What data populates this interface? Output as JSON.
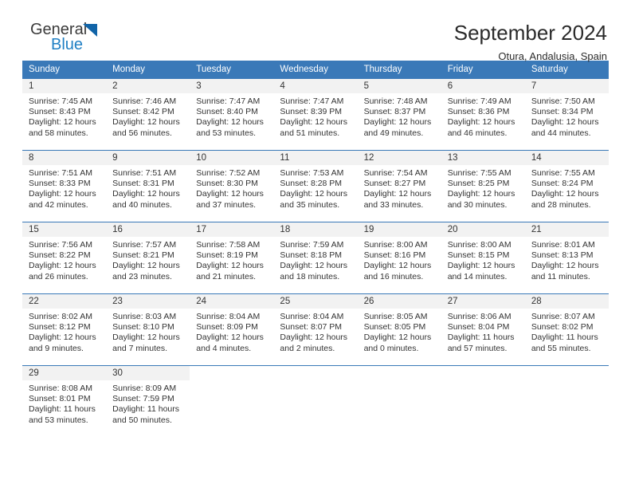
{
  "brand": {
    "line1": "General",
    "line2": "Blue",
    "triangle_icon": "triangle-icon"
  },
  "header": {
    "title": "September 2024",
    "subtitle": "Otura, Andalusia, Spain"
  },
  "colors": {
    "header_blue": "#3a79b8",
    "brand_blue": "#1f7fc4",
    "daynum_bg": "#f2f2f2"
  },
  "weekdays": [
    "Sunday",
    "Monday",
    "Tuesday",
    "Wednesday",
    "Thursday",
    "Friday",
    "Saturday"
  ],
  "weeks": [
    [
      {
        "day": "1",
        "sunrise": "Sunrise: 7:45 AM",
        "sunset": "Sunset: 8:43 PM",
        "daylight1": "Daylight: 12 hours",
        "daylight2": "and 58 minutes."
      },
      {
        "day": "2",
        "sunrise": "Sunrise: 7:46 AM",
        "sunset": "Sunset: 8:42 PM",
        "daylight1": "Daylight: 12 hours",
        "daylight2": "and 56 minutes."
      },
      {
        "day": "3",
        "sunrise": "Sunrise: 7:47 AM",
        "sunset": "Sunset: 8:40 PM",
        "daylight1": "Daylight: 12 hours",
        "daylight2": "and 53 minutes."
      },
      {
        "day": "4",
        "sunrise": "Sunrise: 7:47 AM",
        "sunset": "Sunset: 8:39 PM",
        "daylight1": "Daylight: 12 hours",
        "daylight2": "and 51 minutes."
      },
      {
        "day": "5",
        "sunrise": "Sunrise: 7:48 AM",
        "sunset": "Sunset: 8:37 PM",
        "daylight1": "Daylight: 12 hours",
        "daylight2": "and 49 minutes."
      },
      {
        "day": "6",
        "sunrise": "Sunrise: 7:49 AM",
        "sunset": "Sunset: 8:36 PM",
        "daylight1": "Daylight: 12 hours",
        "daylight2": "and 46 minutes."
      },
      {
        "day": "7",
        "sunrise": "Sunrise: 7:50 AM",
        "sunset": "Sunset: 8:34 PM",
        "daylight1": "Daylight: 12 hours",
        "daylight2": "and 44 minutes."
      }
    ],
    [
      {
        "day": "8",
        "sunrise": "Sunrise: 7:51 AM",
        "sunset": "Sunset: 8:33 PM",
        "daylight1": "Daylight: 12 hours",
        "daylight2": "and 42 minutes."
      },
      {
        "day": "9",
        "sunrise": "Sunrise: 7:51 AM",
        "sunset": "Sunset: 8:31 PM",
        "daylight1": "Daylight: 12 hours",
        "daylight2": "and 40 minutes."
      },
      {
        "day": "10",
        "sunrise": "Sunrise: 7:52 AM",
        "sunset": "Sunset: 8:30 PM",
        "daylight1": "Daylight: 12 hours",
        "daylight2": "and 37 minutes."
      },
      {
        "day": "11",
        "sunrise": "Sunrise: 7:53 AM",
        "sunset": "Sunset: 8:28 PM",
        "daylight1": "Daylight: 12 hours",
        "daylight2": "and 35 minutes."
      },
      {
        "day": "12",
        "sunrise": "Sunrise: 7:54 AM",
        "sunset": "Sunset: 8:27 PM",
        "daylight1": "Daylight: 12 hours",
        "daylight2": "and 33 minutes."
      },
      {
        "day": "13",
        "sunrise": "Sunrise: 7:55 AM",
        "sunset": "Sunset: 8:25 PM",
        "daylight1": "Daylight: 12 hours",
        "daylight2": "and 30 minutes."
      },
      {
        "day": "14",
        "sunrise": "Sunrise: 7:55 AM",
        "sunset": "Sunset: 8:24 PM",
        "daylight1": "Daylight: 12 hours",
        "daylight2": "and 28 minutes."
      }
    ],
    [
      {
        "day": "15",
        "sunrise": "Sunrise: 7:56 AM",
        "sunset": "Sunset: 8:22 PM",
        "daylight1": "Daylight: 12 hours",
        "daylight2": "and 26 minutes."
      },
      {
        "day": "16",
        "sunrise": "Sunrise: 7:57 AM",
        "sunset": "Sunset: 8:21 PM",
        "daylight1": "Daylight: 12 hours",
        "daylight2": "and 23 minutes."
      },
      {
        "day": "17",
        "sunrise": "Sunrise: 7:58 AM",
        "sunset": "Sunset: 8:19 PM",
        "daylight1": "Daylight: 12 hours",
        "daylight2": "and 21 minutes."
      },
      {
        "day": "18",
        "sunrise": "Sunrise: 7:59 AM",
        "sunset": "Sunset: 8:18 PM",
        "daylight1": "Daylight: 12 hours",
        "daylight2": "and 18 minutes."
      },
      {
        "day": "19",
        "sunrise": "Sunrise: 8:00 AM",
        "sunset": "Sunset: 8:16 PM",
        "daylight1": "Daylight: 12 hours",
        "daylight2": "and 16 minutes."
      },
      {
        "day": "20",
        "sunrise": "Sunrise: 8:00 AM",
        "sunset": "Sunset: 8:15 PM",
        "daylight1": "Daylight: 12 hours",
        "daylight2": "and 14 minutes."
      },
      {
        "day": "21",
        "sunrise": "Sunrise: 8:01 AM",
        "sunset": "Sunset: 8:13 PM",
        "daylight1": "Daylight: 12 hours",
        "daylight2": "and 11 minutes."
      }
    ],
    [
      {
        "day": "22",
        "sunrise": "Sunrise: 8:02 AM",
        "sunset": "Sunset: 8:12 PM",
        "daylight1": "Daylight: 12 hours",
        "daylight2": "and 9 minutes."
      },
      {
        "day": "23",
        "sunrise": "Sunrise: 8:03 AM",
        "sunset": "Sunset: 8:10 PM",
        "daylight1": "Daylight: 12 hours",
        "daylight2": "and 7 minutes."
      },
      {
        "day": "24",
        "sunrise": "Sunrise: 8:04 AM",
        "sunset": "Sunset: 8:09 PM",
        "daylight1": "Daylight: 12 hours",
        "daylight2": "and 4 minutes."
      },
      {
        "day": "25",
        "sunrise": "Sunrise: 8:04 AM",
        "sunset": "Sunset: 8:07 PM",
        "daylight1": "Daylight: 12 hours",
        "daylight2": "and 2 minutes."
      },
      {
        "day": "26",
        "sunrise": "Sunrise: 8:05 AM",
        "sunset": "Sunset: 8:05 PM",
        "daylight1": "Daylight: 12 hours",
        "daylight2": "and 0 minutes."
      },
      {
        "day": "27",
        "sunrise": "Sunrise: 8:06 AM",
        "sunset": "Sunset: 8:04 PM",
        "daylight1": "Daylight: 11 hours",
        "daylight2": "and 57 minutes."
      },
      {
        "day": "28",
        "sunrise": "Sunrise: 8:07 AM",
        "sunset": "Sunset: 8:02 PM",
        "daylight1": "Daylight: 11 hours",
        "daylight2": "and 55 minutes."
      }
    ],
    [
      {
        "day": "29",
        "sunrise": "Sunrise: 8:08 AM",
        "sunset": "Sunset: 8:01 PM",
        "daylight1": "Daylight: 11 hours",
        "daylight2": "and 53 minutes."
      },
      {
        "day": "30",
        "sunrise": "Sunrise: 8:09 AM",
        "sunset": "Sunset: 7:59 PM",
        "daylight1": "Daylight: 11 hours",
        "daylight2": "and 50 minutes."
      },
      {
        "day": "",
        "sunrise": "",
        "sunset": "",
        "daylight1": "",
        "daylight2": ""
      },
      {
        "day": "",
        "sunrise": "",
        "sunset": "",
        "daylight1": "",
        "daylight2": ""
      },
      {
        "day": "",
        "sunrise": "",
        "sunset": "",
        "daylight1": "",
        "daylight2": ""
      },
      {
        "day": "",
        "sunrise": "",
        "sunset": "",
        "daylight1": "",
        "daylight2": ""
      },
      {
        "day": "",
        "sunrise": "",
        "sunset": "",
        "daylight1": "",
        "daylight2": ""
      }
    ]
  ]
}
